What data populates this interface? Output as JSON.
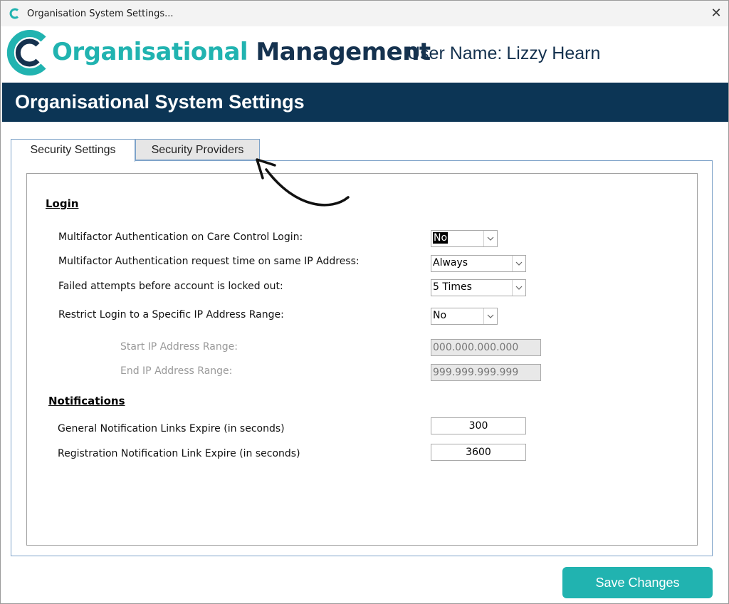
{
  "window": {
    "title": "Organisation System Settings...",
    "close_glyph": "✕"
  },
  "header": {
    "logo_word1": "Organisational",
    "logo_word2": "Management",
    "user_label": "User Name:",
    "user_name": "Lizzy Hearn"
  },
  "banner": {
    "title": "Organisational System Settings"
  },
  "tabs": [
    {
      "label": "Security Settings",
      "active": true
    },
    {
      "label": "Security Providers",
      "active": false
    }
  ],
  "login": {
    "heading": "Login",
    "mfa_login_label": "Multifactor Authentication on Care Control Login:",
    "mfa_login_value": "No",
    "mfa_ip_label": "Multifactor Authentication request time on same IP Address:",
    "mfa_ip_value": "Always",
    "failed_label": "Failed attempts before account is locked out:",
    "failed_value": "5 Times",
    "restrict_label": "Restrict Login to a Specific IP Address Range:",
    "restrict_value": "No",
    "start_ip_label": "Start IP Address Range:",
    "start_ip_value": "000.000.000.000",
    "end_ip_label": "End IP Address Range:",
    "end_ip_value": "999.999.999.999"
  },
  "notifications": {
    "heading": "Notifications",
    "general_label": "General Notification Links Expire (in seconds)",
    "general_value": "300",
    "registration_label": "Registration Notification Link Expire (in seconds)",
    "registration_value": "3600"
  },
  "save_button": "Save Changes",
  "colors": {
    "teal": "#21b3b0",
    "navy": "#0c3555",
    "dark_text": "#15324f"
  }
}
